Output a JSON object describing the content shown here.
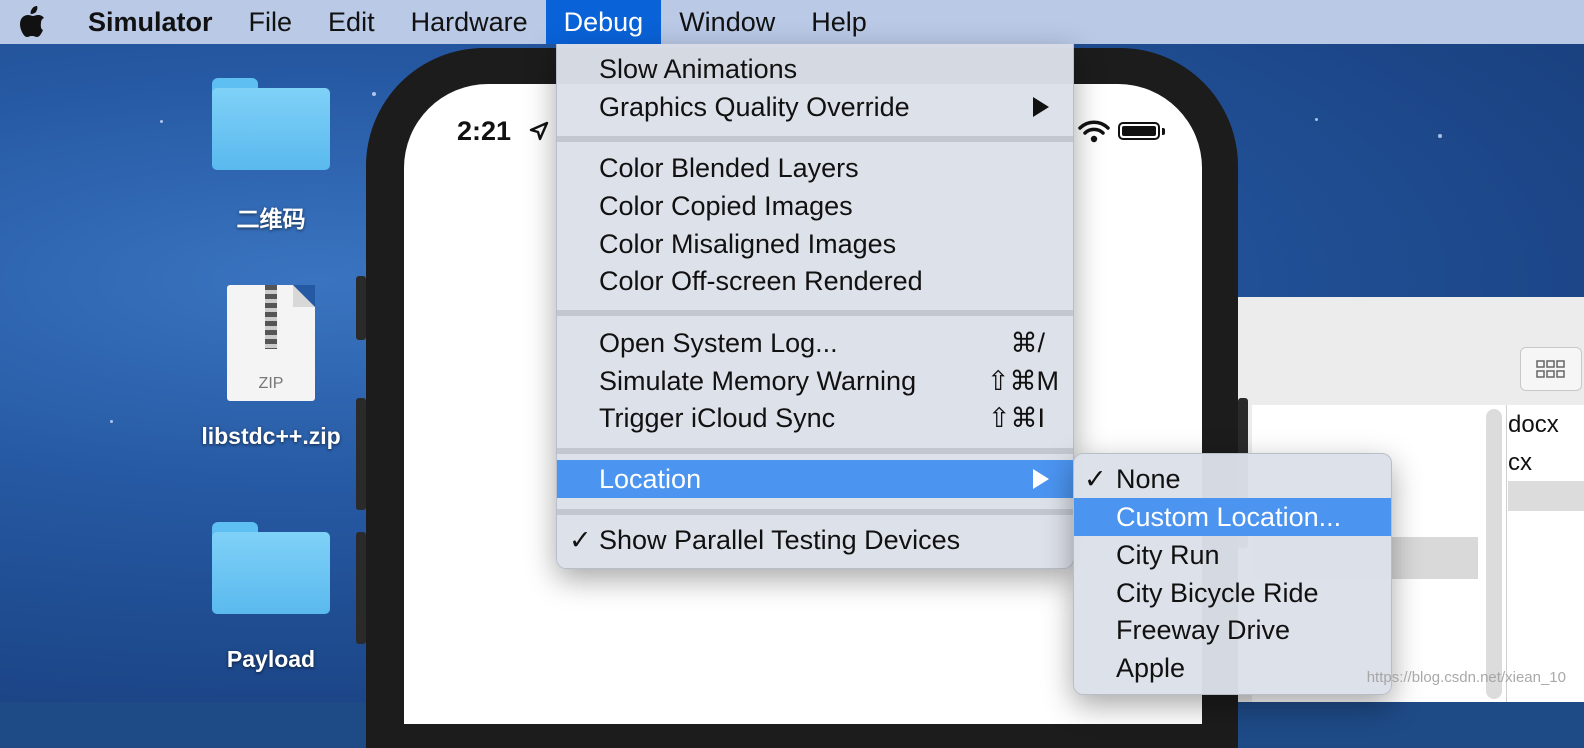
{
  "menubar": {
    "app_name": "Simulator",
    "items": [
      "File",
      "Edit",
      "Hardware",
      "Debug",
      "Window",
      "Help"
    ],
    "active_item": "Debug"
  },
  "desktop": {
    "icons": [
      {
        "label": "二维码",
        "type": "folder"
      },
      {
        "label": "libstdc++.zip",
        "type": "zip",
        "badge": "ZIP"
      },
      {
        "label": "Payload",
        "type": "folder"
      }
    ]
  },
  "simulator": {
    "time": "2:21",
    "status_icons": [
      "location-arrow-icon",
      "wifi-icon",
      "battery-icon"
    ]
  },
  "debug_menu": {
    "slow_animations": "Slow Animations",
    "graphics_quality": "Graphics Quality Override",
    "color_blended": "Color Blended Layers",
    "color_copied": "Color Copied Images",
    "color_misaligned": "Color Misaligned Images",
    "color_offscreen": "Color Off-screen Rendered",
    "open_system_log": "Open System Log...",
    "open_system_log_shortcut": "⌘/",
    "simulate_memory": "Simulate Memory Warning",
    "simulate_memory_shortcut": "⇧⌘M",
    "trigger_icloud": "Trigger iCloud Sync",
    "trigger_icloud_shortcut": "⇧⌘I",
    "location": "Location",
    "show_parallel": "Show Parallel Testing Devices",
    "check_mark": "✓"
  },
  "location_submenu": {
    "none": "None",
    "custom": "Custom Location...",
    "city_run": "City Run",
    "city_bicycle": "City Bicycle Ride",
    "freeway": "Freeway Drive",
    "apple": "Apple",
    "check_mark": "✓"
  },
  "finder": {
    "file1": "docx",
    "file2": "cx"
  },
  "watermark": "https://blog.csdn.net/xiean_10",
  "colors": {
    "menubar": "#b9c9e6",
    "active_menu": "#0a62d8",
    "highlight": "#4b94f0",
    "menu_bg": "#dce0e8"
  }
}
